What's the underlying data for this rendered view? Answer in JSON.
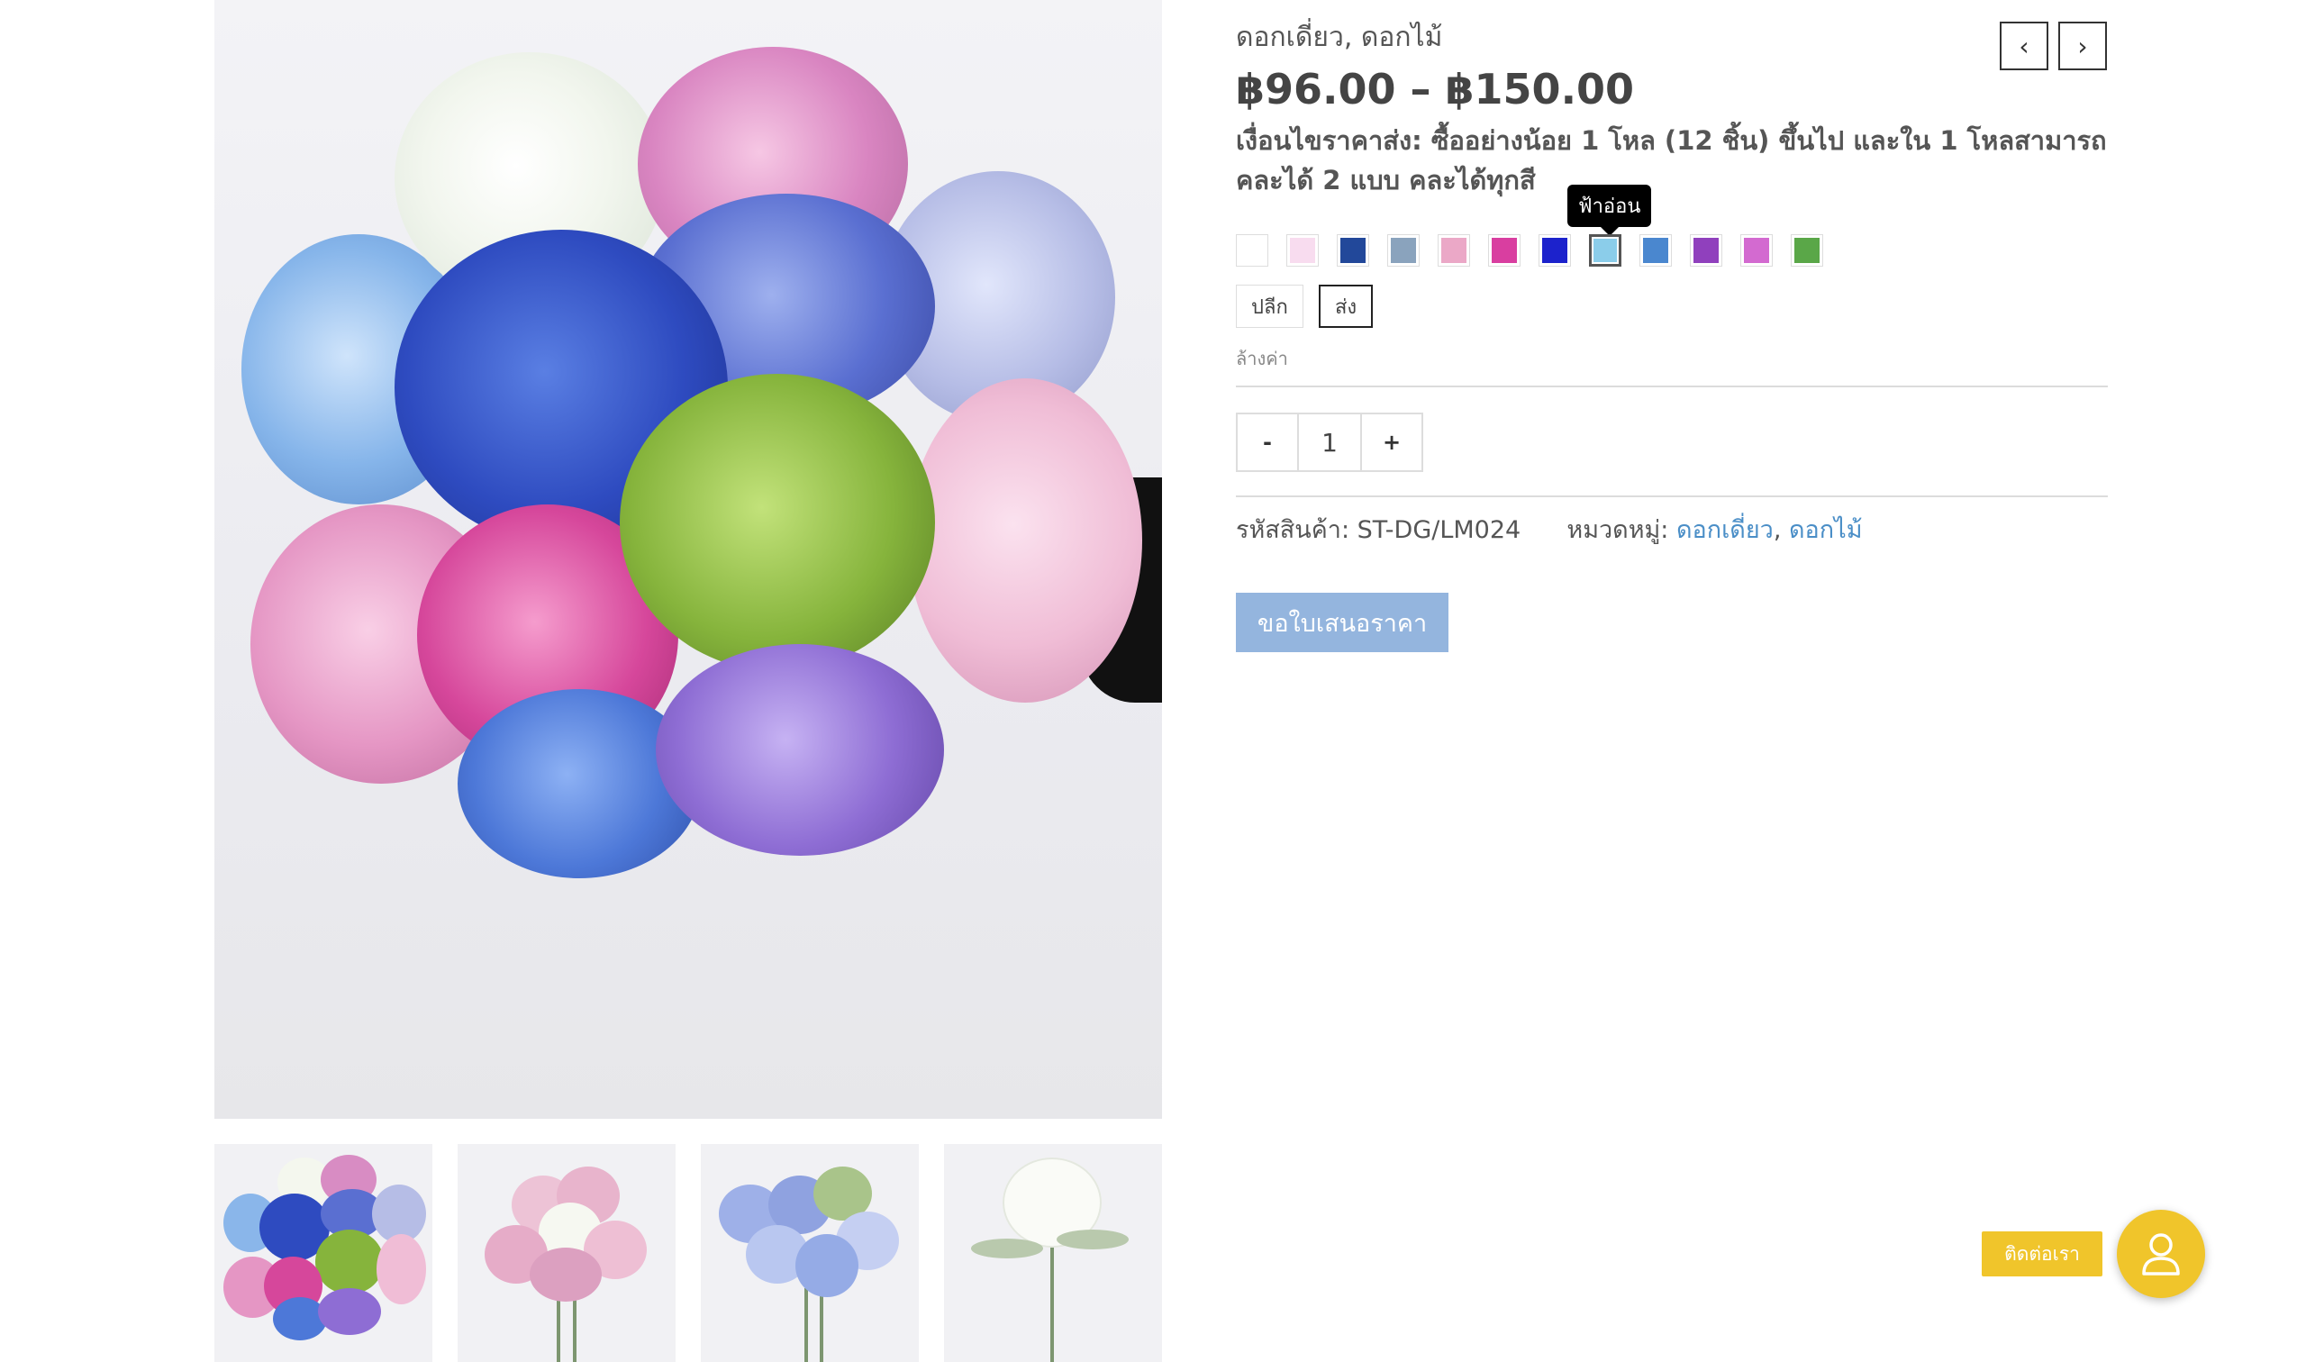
{
  "gallery": {
    "main_image_alt": "",
    "thumbnails": [
      {
        "name": "thumbnail-mixed"
      },
      {
        "name": "thumbnail-pink"
      },
      {
        "name": "thumbnail-blue"
      },
      {
        "name": "thumbnail-white"
      }
    ]
  },
  "product": {
    "categories_text": "ดอกเดี่ยว, ดอกไม้",
    "price_range": "฿96.00 – ฿150.00",
    "wholesale_note": "เงื่อนไขราคาส่ง: ซื้ออย่างน้อย 1 โหล (12 ชิ้น) ขึ้นไป และใน 1 โหลสามารถคละได้ 2 แบบ คละได้ทุกสี",
    "color_tooltip": "ฟ้าอ่อน",
    "color_swatches": [
      {
        "color": "#ffffff"
      },
      {
        "color": "#f8dcef"
      },
      {
        "color": "#22489a"
      },
      {
        "color": "#8aa3bd"
      },
      {
        "color": "#eba8c7"
      },
      {
        "color": "#d93ea0"
      },
      {
        "color": "#1c22cc"
      },
      {
        "color": "#8bcdea",
        "selected": true
      },
      {
        "color": "#4a87cf"
      },
      {
        "color": "#9040bd"
      },
      {
        "color": "#d36ad0"
      },
      {
        "color": "#5aa748"
      }
    ],
    "options": [
      {
        "label": "ปลีก",
        "selected": false
      },
      {
        "label": "ส่ง",
        "selected": true
      }
    ],
    "clear_label": "ล้างค่า",
    "quantity": {
      "minus_label": "-",
      "value": "1",
      "plus_label": "+"
    },
    "sku_label": "รหัสสินค้า:",
    "sku_value": "ST-DG/LM024",
    "category_label": "หมวดหมู่:",
    "category_links": [
      "ดอกเดี่ยว",
      "ดอกไม้"
    ],
    "category_separator": ",",
    "quote_button": "ขอใบเสนอราคา"
  },
  "nav": {
    "prev_icon": "‹",
    "next_icon": "›"
  },
  "contact": {
    "label": "ติดต่อเรา",
    "icon": "user-icon"
  }
}
